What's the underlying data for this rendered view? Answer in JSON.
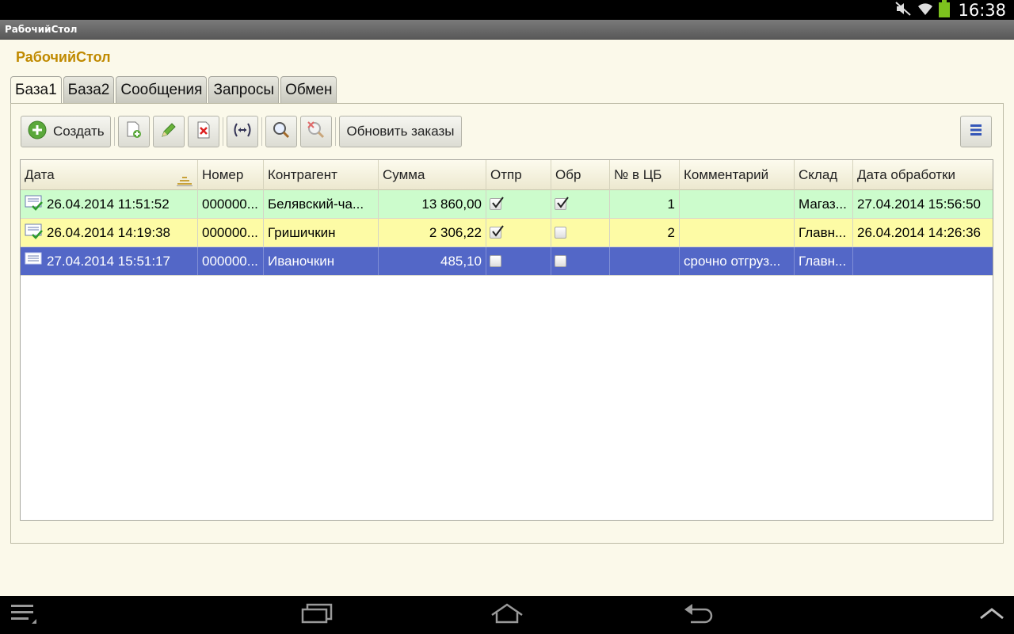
{
  "status_bar": {
    "time": "16:38"
  },
  "window": {
    "title": "РабочийСтол"
  },
  "form": {
    "title": "РабочийСтол"
  },
  "tabs": [
    {
      "label": "База1",
      "active": true
    },
    {
      "label": "База2",
      "active": false
    },
    {
      "label": "Сообщения",
      "active": false
    },
    {
      "label": "Запросы",
      "active": false
    },
    {
      "label": "Обмен",
      "active": false
    }
  ],
  "toolbar": {
    "create_label": "Создать",
    "refresh_orders_label": "Обновить заказы"
  },
  "table": {
    "columns": [
      "Дата",
      "Номер",
      "Контрагент",
      "Сумма",
      "Отпр",
      "Обр",
      "№ в ЦБ",
      "Комментарий",
      "Склад",
      "Дата обработки"
    ],
    "rows": [
      {
        "date": "26.04.2014 11:51:52",
        "number": "000000...",
        "counterparty": "Белявский-ча...",
        "sum": "13 860,00",
        "sent": true,
        "processed": true,
        "cb_number": "1",
        "comment": "",
        "warehouse": "Магаз...",
        "processed_date": "27.04.2014 15:56:50"
      },
      {
        "date": "26.04.2014 14:19:38",
        "number": "000000...",
        "counterparty": "Гришичкин",
        "sum": "2 306,22",
        "sent": true,
        "processed": false,
        "cb_number": "2",
        "comment": "",
        "warehouse": "Главн...",
        "processed_date": "26.04.2014 14:26:36"
      },
      {
        "date": "27.04.2014 15:51:17",
        "number": "000000...",
        "counterparty": "Иваночкин",
        "sum": "485,10",
        "sent": false,
        "processed": false,
        "cb_number": "",
        "comment": "срочно отгруз...",
        "warehouse": "Главн...",
        "processed_date": ""
      }
    ]
  },
  "colors": {
    "row_green": "#ccfccc",
    "row_yellow": "#fdfba5",
    "row_selected": "#5367c7",
    "title_accent": "#c08a00"
  }
}
